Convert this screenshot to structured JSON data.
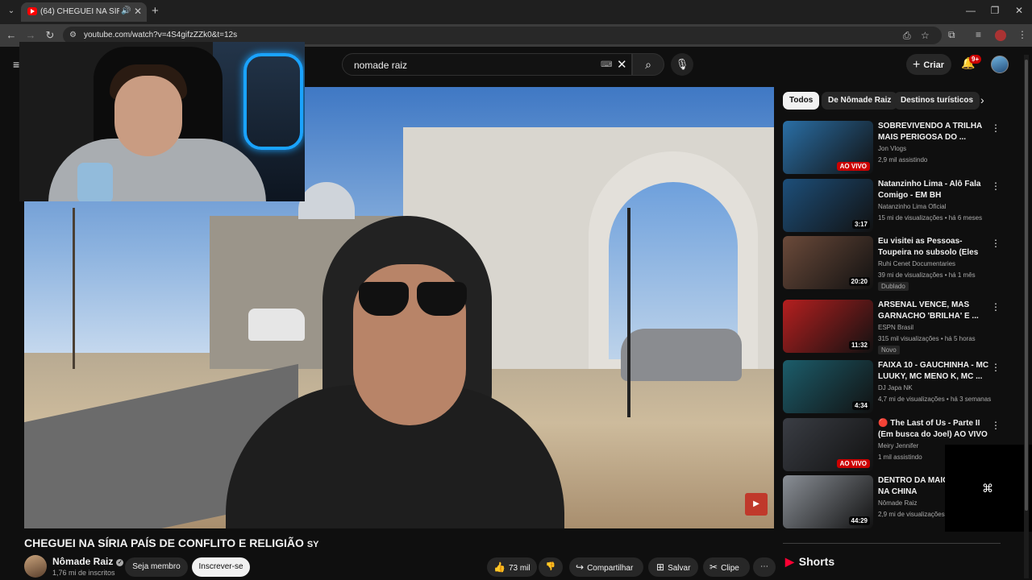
{
  "browser": {
    "tab_title": "(64) CHEGUEI NA SÍRIA PAÍ",
    "url": "youtube.com/watch?v=4S4gifzZZk0&t=12s"
  },
  "header": {
    "search_value": "nomade raiz",
    "create_label": "Criar",
    "notification_count": "9+"
  },
  "video": {
    "title": "CHEGUEI NA SÍRIA PAÍS DE CONFLITO E RELIGIÃO",
    "title_suffix": "SY",
    "channel_name": "Nômade Raiz",
    "subscribers": "1,76 mi de inscritos",
    "join_label": "Seja membro",
    "subscribe_label": "Inscrever-se",
    "likes": "73 mil",
    "share_label": "Compartilhar",
    "save_label": "Salvar",
    "clip_label": "Clipe"
  },
  "chips": [
    "Todos",
    "De Nômade Raiz",
    "Destinos turísticos"
  ],
  "recommendations": [
    {
      "title": "SOBREVIVENDO A TRILHA MAIS PERIGOSA DO ...",
      "channel": "Jon Vlogs",
      "meta": "2,9 mil assistindo",
      "badge": "AO VIVO",
      "tag": "",
      "thumb_color": "#2a6fa6"
    },
    {
      "title": "Natanzinho Lima - Alô Fala Comigo - EM BH",
      "channel": "Natanzinho Lima Oficial",
      "meta": "15 mi de visualizações • há 6 meses",
      "badge": "3:17",
      "tag": "",
      "thumb_color": "#1d4f7a"
    },
    {
      "title": "Eu visitei as Pessoas-Toupeira no subsolo (Eles vivem sem sol)",
      "channel": "Ruhi Cenet Documentaries",
      "meta": "39 mi de visualizações • há 1 mês",
      "badge": "20:20",
      "tag": "Dublado",
      "thumb_color": "#6b4a3a"
    },
    {
      "title": "ARSENAL VENCE, MAS GARNACHO 'BRILHA' E ...",
      "channel": "ESPN Brasil",
      "meta": "315 mil visualizações • há 5 horas",
      "badge": "11:32",
      "tag": "Novo",
      "thumb_color": "#b51f1f"
    },
    {
      "title": "FAIXA 10 - GAUCHINHA - MC LUUKY, MC MENO K, MC ...",
      "channel": "DJ Japa NK",
      "meta": "4,7 mi de visualizações • há 3 semanas",
      "badge": "4:34",
      "tag": "",
      "thumb_color": "#1c5d6b"
    },
    {
      "title": "🔴 The Last of Us - Parte II (Em busca do Joel) AO VIVO - PC ...",
      "channel": "Meiry Jennifer",
      "meta": "1 mil assistindo",
      "badge": "AO VIVO",
      "tag": "",
      "thumb_color": "#3a3d44"
    },
    {
      "title": "DENTRO DA MAIOR MUNDO NA CHINA",
      "channel": "Nômade Raiz",
      "meta": "2,9 mi de visualizações",
      "badge": "44:29",
      "tag": "",
      "thumb_color": "#8a8f96"
    }
  ],
  "shorts_label": "Shorts"
}
